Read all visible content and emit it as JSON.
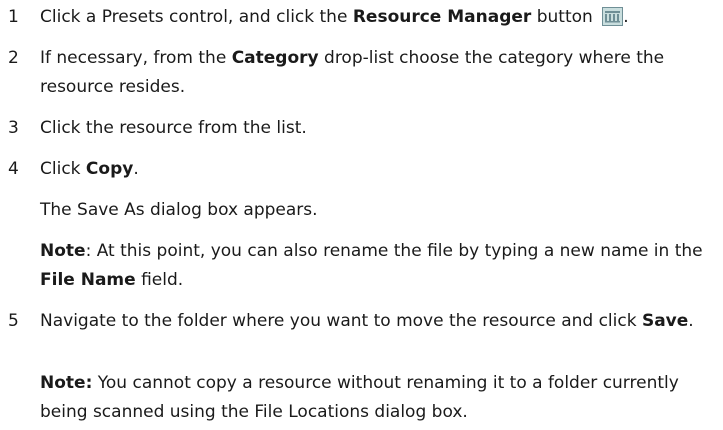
{
  "steps": [
    {
      "number": "1",
      "parts": [
        "Click a Presets control, and click the ",
        "Resource Manager",
        " button "
      ],
      "icon": "resource-manager-icon",
      "tail": "."
    },
    {
      "number": "2",
      "parts": [
        "If necessary, from the ",
        "Category",
        " drop-list choose the category where the resource resides."
      ]
    },
    {
      "number": "3",
      "text": "Click the resource from the list."
    },
    {
      "number": "4",
      "parts": [
        "Click ",
        "Copy",
        "."
      ],
      "result": "The Save As dialog box appears.",
      "note": {
        "label": "Note",
        "parts": [
          ": At this point, you can also rename the file by typing a new name in the ",
          "File Name",
          " field."
        ]
      }
    },
    {
      "number": "5",
      "parts": [
        "Navigate to the folder where you want to move the resource and click ",
        "Save",
        "."
      ],
      "note": {
        "label": "Note:",
        "text": " You cannot copy a resource without renaming it to a folder currently being scanned using the File Locations dialog box."
      }
    }
  ],
  "colors": {
    "text": "#1a1a1a",
    "icon_fill": "#c9dede",
    "icon_stroke": "#6f8f96"
  }
}
